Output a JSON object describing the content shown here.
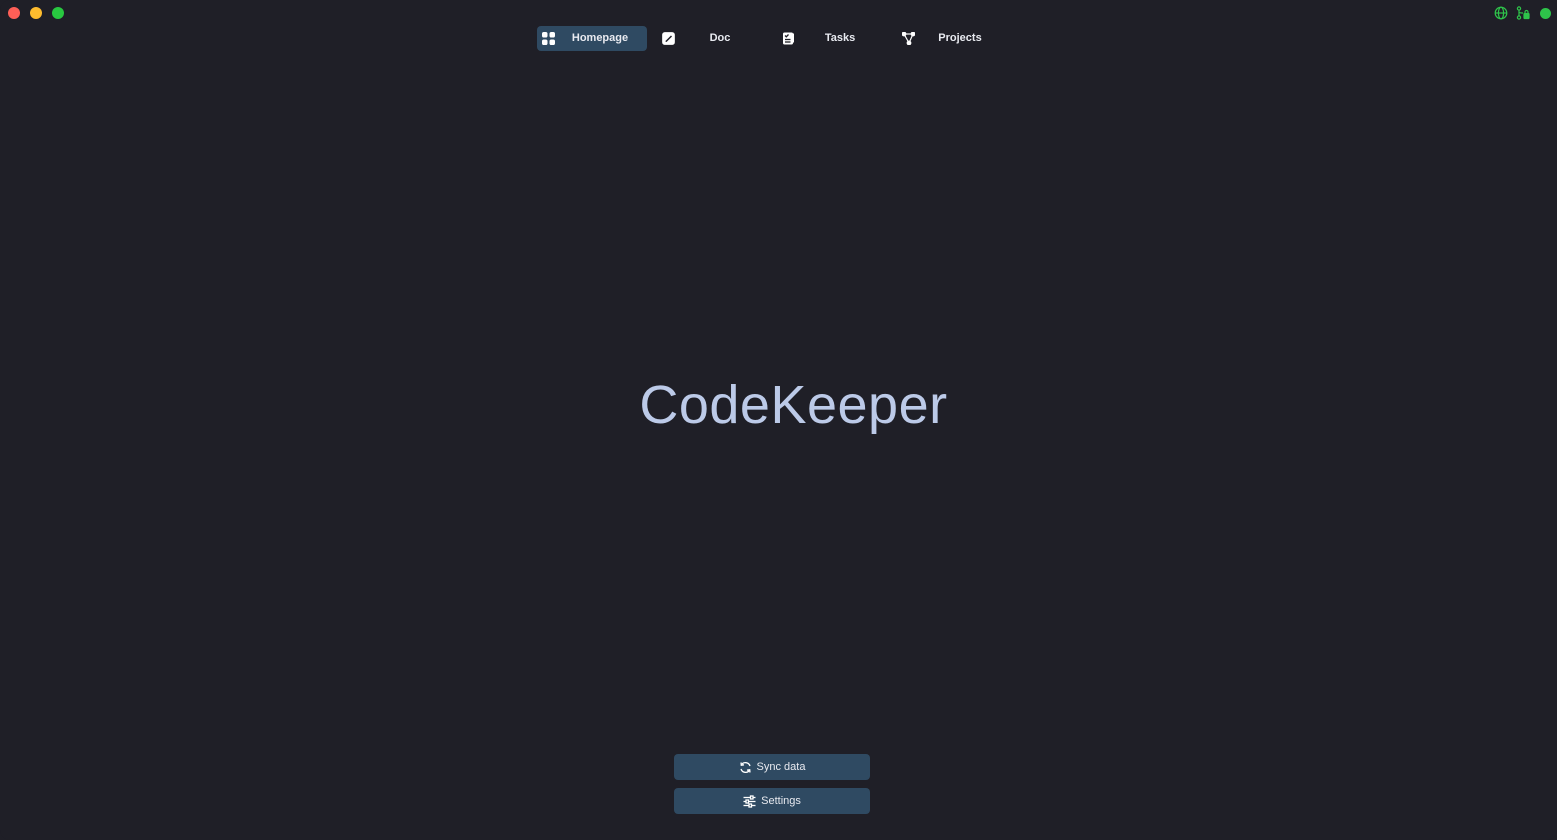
{
  "window": {
    "controls": [
      "close",
      "minimize",
      "maximize"
    ]
  },
  "status": {
    "icons": [
      "globe-icon",
      "branch-lock-icon",
      "online-dot"
    ],
    "accent_color": "#2ec44a"
  },
  "nav": {
    "tabs": [
      {
        "label": "Homepage",
        "icon": "grid-icon",
        "active": true
      },
      {
        "label": "Doc",
        "icon": "edit-icon",
        "active": false
      },
      {
        "label": "Tasks",
        "icon": "checklist-icon",
        "active": false
      },
      {
        "label": "Projects",
        "icon": "graph-icon",
        "active": false
      }
    ],
    "active_color": "#2f4a62"
  },
  "main": {
    "title": "CodeKeeper",
    "title_color": "#bccae8"
  },
  "actions": {
    "sync_label": "Sync data",
    "sync_icon": "refresh-icon",
    "settings_label": "Settings",
    "settings_icon": "sliders-icon"
  }
}
